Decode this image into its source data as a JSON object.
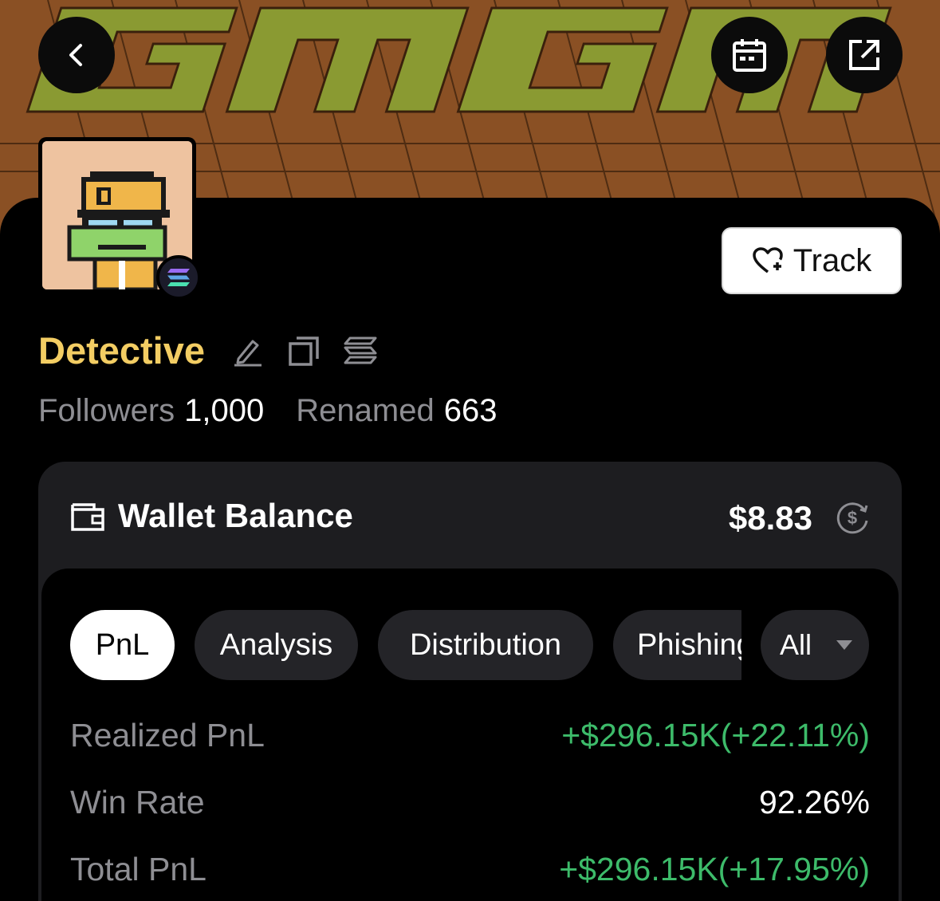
{
  "header": {
    "banner_text": "GMGN",
    "back_icon": "chevron-left-icon",
    "calendar_icon": "calendar-icon",
    "share_icon": "external-link-icon"
  },
  "profile": {
    "name": "Detective",
    "track_label": "Track",
    "followers_label": "Followers",
    "followers_value": "1,000",
    "renamed_label": "Renamed",
    "renamed_value": "663",
    "chain": "solana-icon"
  },
  "wallet": {
    "label": "Wallet Balance",
    "amount": "$8.83"
  },
  "tabs": [
    {
      "label": "PnL",
      "active": true
    },
    {
      "label": "Analysis",
      "active": false
    },
    {
      "label": "Distribution",
      "active": false
    },
    {
      "label": "Phishing",
      "active": false
    }
  ],
  "filter": {
    "selected": "All"
  },
  "metrics": [
    {
      "label": "Realized PnL",
      "value": "+$296.15K(+22.11%)",
      "color": "#3dbb6a"
    },
    {
      "label": "Win Rate",
      "value": "92.26%",
      "color": "#ffffff"
    },
    {
      "label": "Total PnL",
      "value": "+$296.15K(+17.95%)",
      "color": "#3dbb6a"
    }
  ],
  "colors": {
    "name": "#f3cd63",
    "positive": "#3dbb6a",
    "banner_bg": "#8a5024",
    "banner_text": "#8a9a32"
  }
}
